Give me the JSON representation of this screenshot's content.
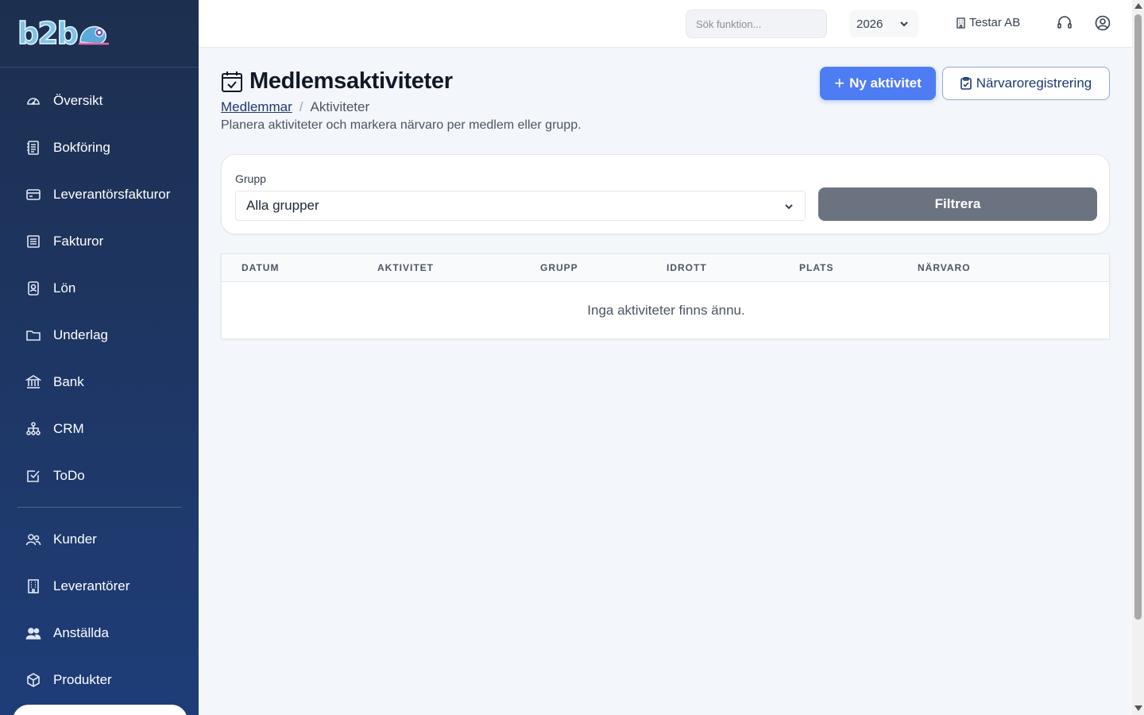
{
  "brand": {
    "logo_text": "b2b"
  },
  "sidebar": {
    "items": [
      {
        "label": "Översikt",
        "icon": "gauge-icon"
      },
      {
        "label": "Bokföring",
        "icon": "ledger-icon"
      },
      {
        "label": "Leverantörsfakturor",
        "icon": "credit-card-icon"
      },
      {
        "label": "Fakturor",
        "icon": "invoice-icon"
      },
      {
        "label": "Lön",
        "icon": "id-badge-icon"
      },
      {
        "label": "Underlag",
        "icon": "folder-icon"
      },
      {
        "label": "Bank",
        "icon": "bank-icon"
      },
      {
        "label": "CRM",
        "icon": "network-icon"
      },
      {
        "label": "ToDo",
        "icon": "checkbox-icon"
      }
    ],
    "items2": [
      {
        "label": "Kunder",
        "icon": "users-icon"
      },
      {
        "label": "Leverantörer",
        "icon": "building-icon"
      },
      {
        "label": "Anställda",
        "icon": "people-icon"
      },
      {
        "label": "Produkter",
        "icon": "box-icon"
      }
    ]
  },
  "header": {
    "search_placeholder": "Sök funktion...",
    "year": "2026",
    "company": "Testar AB"
  },
  "page": {
    "title": "Medlemsaktiviteter",
    "breadcrumb_parent": "Medlemmar",
    "breadcrumb_separator": "/",
    "breadcrumb_current": "Aktiviteter",
    "subtitle": "Planera aktiviteter och markera närvaro per medlem eller grupp.",
    "new_button": "Ny aktivitet",
    "attendance_button": "Närvaroregistrering"
  },
  "filter": {
    "label": "Grupp",
    "selected": "Alla grupper",
    "button": "Filtrera"
  },
  "table": {
    "columns": [
      "Datum",
      "Aktivitet",
      "Grupp",
      "Idrott",
      "Plats",
      "Närvaro"
    ],
    "empty_message": "Inga aktiviteter finns ännu."
  }
}
